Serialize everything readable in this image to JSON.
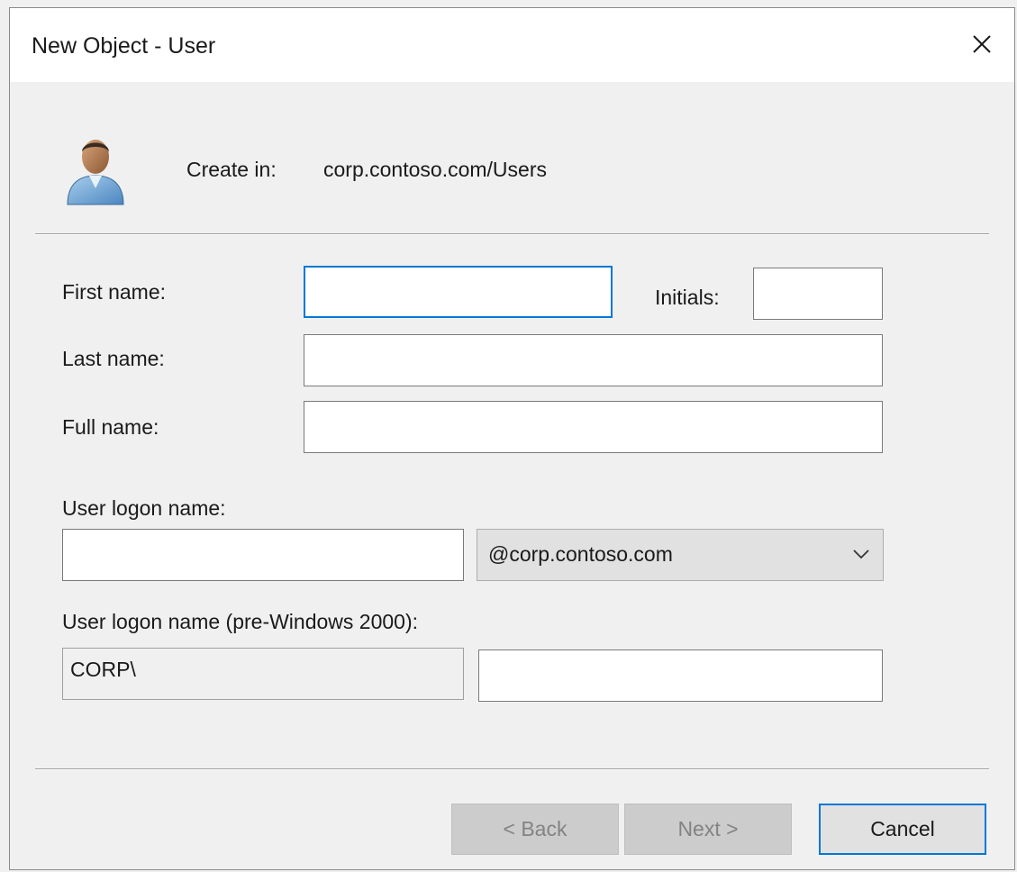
{
  "window": {
    "title": "New Object - User",
    "close_icon": "close-icon"
  },
  "header": {
    "icon": "user-icon",
    "create_in_label": "Create in:",
    "create_in_path": "corp.contoso.com/Users"
  },
  "form": {
    "first_name_label": "First name:",
    "first_name_value": "",
    "initials_label": "Initials:",
    "initials_value": "",
    "last_name_label": "Last name:",
    "last_name_value": "",
    "full_name_label": "Full name:",
    "full_name_value": "",
    "logon_name_label": "User logon name:",
    "logon_name_value": "",
    "upn_suffix_selected": "@corp.contoso.com",
    "pre2000_label": "User logon name (pre-Windows 2000):",
    "pre2000_domain": "CORP\\",
    "pre2000_value": ""
  },
  "buttons": {
    "back_label": "< Back",
    "next_label": "Next >",
    "cancel_label": "Cancel"
  },
  "colors": {
    "accent": "#0078d7",
    "dialog_bg": "#f0f0f0",
    "title_bg": "#ffffff"
  }
}
